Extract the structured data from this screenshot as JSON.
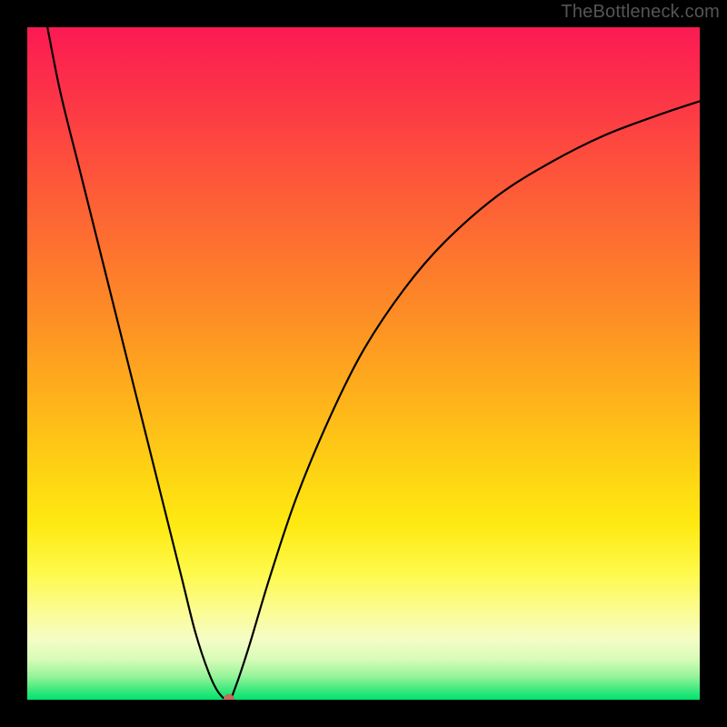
{
  "watermark": "TheBottleneck.com",
  "colors": {
    "frame_bg": "#000000",
    "gradient_top": "#fb1a53",
    "gradient_mid": "#fed014",
    "gradient_bottom": "#00e36e",
    "curve_stroke": "#000000",
    "marker_fill": "#c96a5a"
  },
  "chart_data": {
    "type": "line",
    "title": "",
    "xlabel": "",
    "ylabel": "",
    "xlim": [
      0,
      100
    ],
    "ylim": [
      0,
      100
    ],
    "grid": false,
    "legend_position": "none",
    "annotations": [
      "TheBottleneck.com"
    ],
    "series": [
      {
        "name": "curve",
        "x": [
          3,
          5,
          8,
          12,
          16,
          20,
          23,
          25,
          27,
          28.5,
          30,
          31,
          33,
          36,
          40,
          45,
          50,
          56,
          62,
          70,
          78,
          86,
          94,
          100
        ],
        "y": [
          100,
          90,
          78,
          62,
          46,
          30,
          18,
          10,
          4,
          1,
          0,
          2,
          8,
          18,
          30,
          42,
          52,
          61,
          68,
          75,
          80,
          84,
          87,
          89
        ]
      }
    ],
    "minimum_point": {
      "x": 30,
      "y": 0
    }
  }
}
